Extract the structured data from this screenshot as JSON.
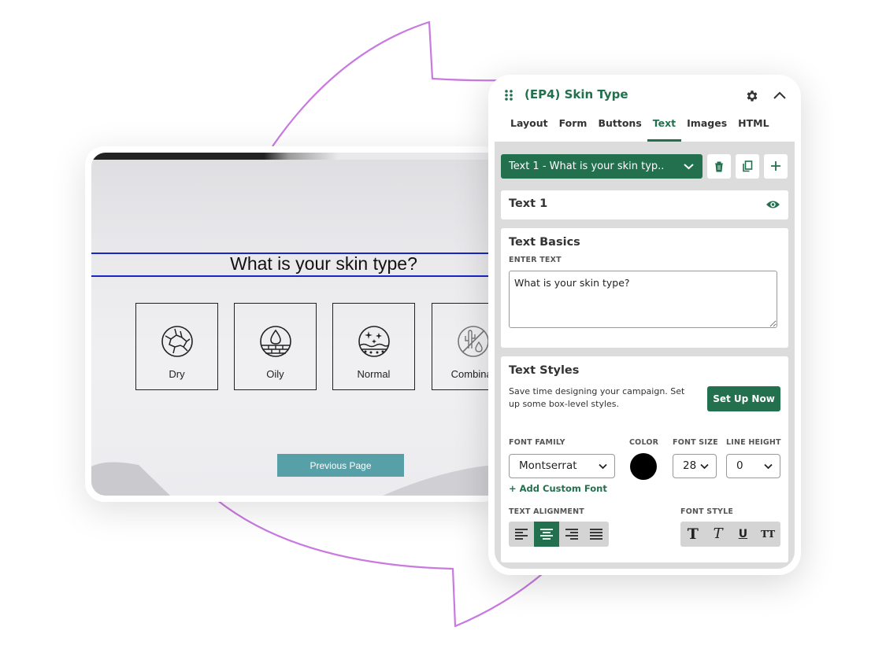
{
  "preview": {
    "question": "What is your skin type?",
    "options": [
      {
        "label": "Dry",
        "icon": "cracked-skin-icon"
      },
      {
        "label": "Oily",
        "icon": "oil-drop-icon"
      },
      {
        "label": "Normal",
        "icon": "sparkle-skin-icon"
      },
      {
        "label": "Combinat",
        "icon": "cactus-no-water-icon"
      }
    ],
    "prev_button": "Previous Page"
  },
  "panel": {
    "title": "(EP4) Skin Type",
    "tabs": [
      "Layout",
      "Form",
      "Buttons",
      "Text",
      "Images",
      "HTML"
    ],
    "active_tab": "Text",
    "text_select": "Text 1 - What is your skin typ..",
    "text1_title": "Text 1",
    "basics": {
      "heading": "Text Basics",
      "enter_text_label": "ENTER TEXT",
      "text_value": "What is your skin type?"
    },
    "styles": {
      "heading": "Text Styles",
      "description": "Save time designing your campaign. Set up some box-level styles.",
      "setup_button": "Set Up Now",
      "font_family_label": "FONT FAMILY",
      "font_family": "Montserrat",
      "color_label": "COLOR",
      "color": "#000000",
      "font_size_label": "FONT SIZE",
      "font_size": "28",
      "line_height_label": "LINE HEIGHT",
      "line_height": "0",
      "add_font": "+ Add Custom Font",
      "alignment_label": "TEXT ALIGNMENT",
      "alignment": "center",
      "font_style_label": "FONT STYLE",
      "font_styles": [
        "T",
        "T",
        "U",
        "TT"
      ]
    }
  },
  "colors": {
    "brand_green": "#23704f",
    "arrow_purple": "#c979e0",
    "prev_button_bg": "#58a0a7",
    "question_band": "#1726c4"
  }
}
